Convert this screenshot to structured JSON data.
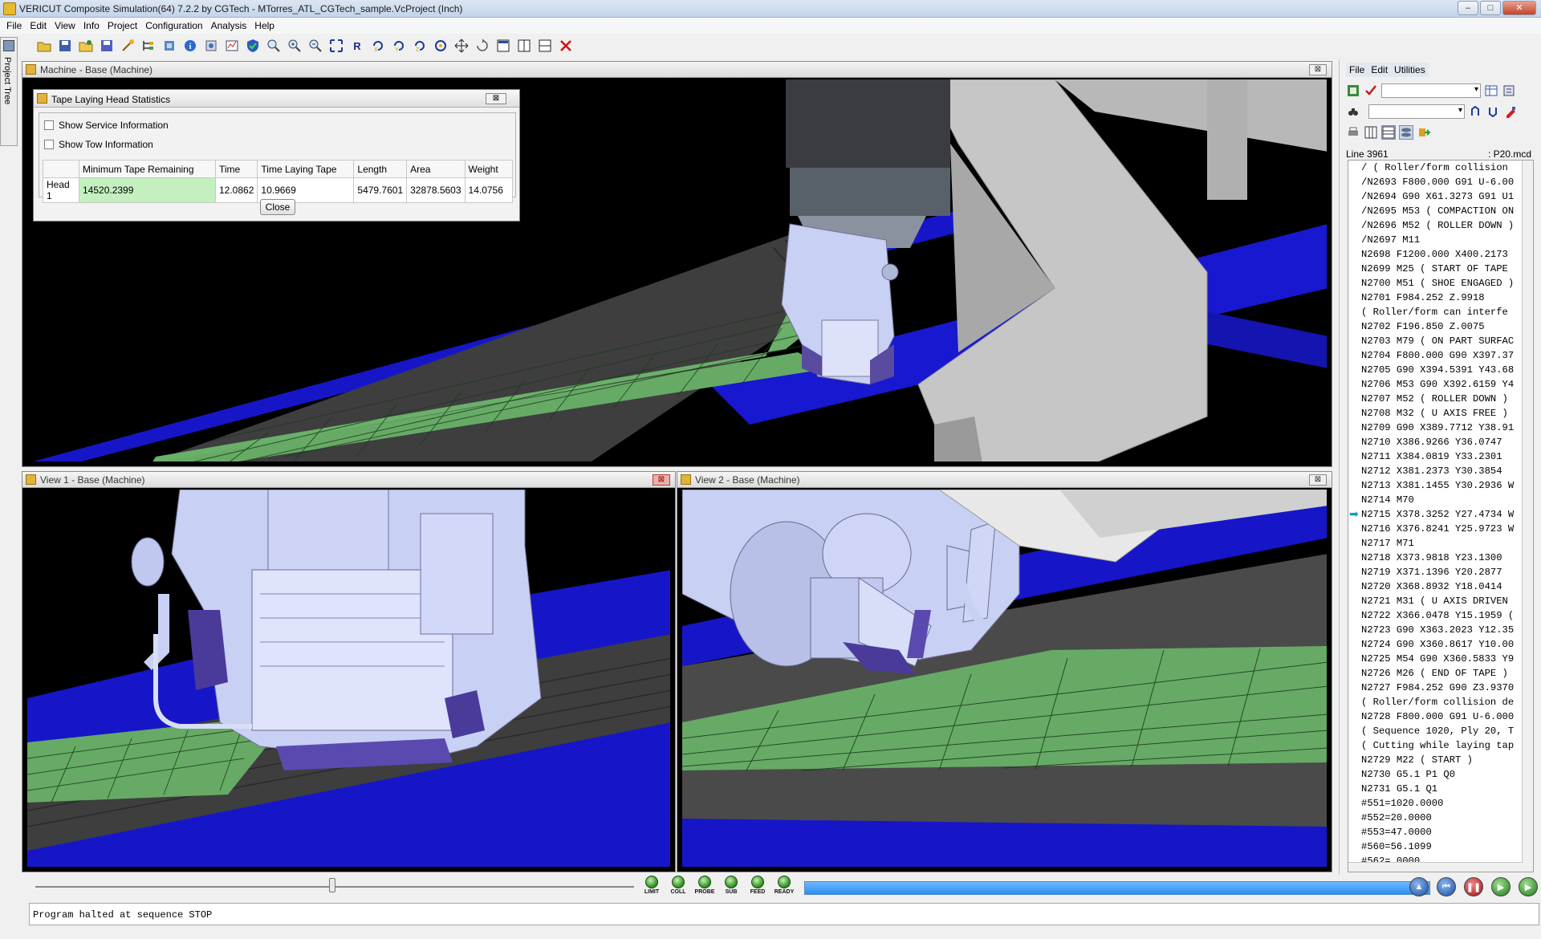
{
  "window": {
    "title": "VERICUT Composite Simulation(64)  7.2.2 by CGTech - MTorres_ATL_CGTech_sample.VcProject (Inch)",
    "btn_minimize": "–",
    "btn_maximize": "□",
    "btn_close": "✕"
  },
  "menu": [
    "File",
    "Edit",
    "View",
    "Info",
    "Project",
    "Configuration",
    "Analysis",
    "Help"
  ],
  "project_tree": {
    "label": "Project Tree"
  },
  "views": {
    "machine": {
      "title": "Machine - Base (Machine)",
      "close": "⊠"
    },
    "view1": {
      "title": "View 1 - Base (Machine)",
      "close": "⊠"
    },
    "view2": {
      "title": "View 2 - Base (Machine)",
      "close": "⊠"
    }
  },
  "stats_dialog": {
    "title": "Tape Laying Head Statistics",
    "close_x": "⊠",
    "show_service": "Show Service Information",
    "show_tow": "Show Tow Information",
    "columns": [
      "",
      "Minimum Tape Remaining",
      "Time",
      "Time Laying Tape",
      "Length",
      "Area",
      "Weight"
    ],
    "row": [
      "Head 1",
      "14520.2399",
      "12.0862",
      "10.9669",
      "5479.7601",
      "32878.5603",
      "14.0756"
    ],
    "close_button": "Close"
  },
  "right_panel": {
    "menu": [
      "File",
      "Edit",
      "Utilities"
    ],
    "line_label": "Line 3961",
    "file_label": ": P20.mcd",
    "code": [
      "/ ( Roller/form collision",
      "/N2693 F800.000 G91 U-6.00",
      "/N2694 G90 X61.3273 G91 U1",
      "/N2695 M53 ( COMPACTION ON",
      "/N2696 M52 ( ROLLER DOWN )",
      "/N2697 M11",
      "N2698 F1200.000 X400.2173",
      "N2699 M25 ( START OF TAPE",
      "N2700 M51 ( SHOE ENGAGED )",
      "N2701 F984.252 Z.9918",
      "( Roller/form can interfe",
      "N2702 F196.850 Z.0075",
      "N2703 M79 ( ON PART SURFAC",
      "N2704 F800.000 G90 X397.37",
      "N2705 G90 X394.5391 Y43.68",
      "N2706 M53 G90 X392.6159 Y4",
      "N2707 M52 ( ROLLER DOWN )",
      "N2708 M32 ( U AXIS FREE )",
      "N2709 G90 X389.7712 Y38.91",
      "N2710 X386.9266 Y36.0747",
      "N2711 X384.0819 Y33.2301",
      "N2712 X381.2373 Y30.3854",
      "N2713 X381.1455 Y30.2936 W",
      "N2714 M70",
      "N2715 X378.3252 Y27.4734 W",
      "N2716 X376.8241 Y25.9723 W",
      "N2717 M71",
      "N2718 X373.9818 Y23.1300",
      "N2719 X371.1396 Y20.2877",
      "N2720 X368.8932 Y18.0414",
      "N2721 M31 ( U AXIS DRIVEN",
      "N2722 X366.0478 Y15.1959 (",
      "N2723 G90 X363.2023 Y12.35",
      "N2724 G90 X360.8617 Y10.00",
      "N2725 M54 G90 X360.5833 Y9",
      "N2726 M26 ( END OF TAPE )",
      "N2727 F984.252 G90 Z3.9370",
      "( Roller/form collision de",
      "N2728 F800.000 G91 U-6.000",
      "( Sequence 1020, Ply 20, T",
      "( Cutting while laying tap",
      "N2729 M22 ( START )",
      "N2730 G5.1 P1 Q0",
      "N2731 G5.1 Q1",
      "#551=1020.0000",
      "#552=20.0000",
      "#553=47.0000",
      "#560=56.1099",
      "#562= 0000"
    ],
    "current_line_index": 24
  },
  "leds": [
    "LIMIT",
    "COLL",
    "PROBE",
    "SUB",
    "FEED",
    "READY"
  ],
  "status_text": "Program halted at sequence STOP",
  "colors": {
    "tape_green": "#6aa66a",
    "rail_blue": "#1a1acc",
    "machine_grey": "#c8c8c8",
    "head_lavender": "#c8d0f4",
    "progress_blue": "#3a97f5"
  }
}
